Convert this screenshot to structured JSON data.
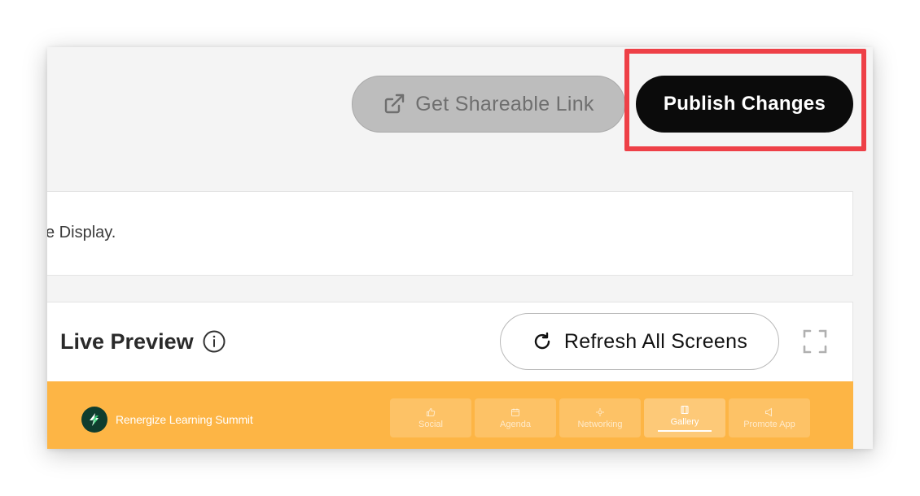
{
  "header": {
    "share_label": "Get Shareable Link",
    "publish_label": "Publish Changes"
  },
  "notice": {
    "text": "e Display."
  },
  "preview": {
    "title": "Live Preview",
    "refresh_label": "Refresh All Screens"
  },
  "banner": {
    "event_name": "Renergize Learning Summit",
    "nav": [
      {
        "label": "Social",
        "icon": "thumbs-up-icon"
      },
      {
        "label": "Agenda",
        "icon": "calendar-icon"
      },
      {
        "label": "Networking",
        "icon": "network-icon"
      },
      {
        "label": "Gallery",
        "icon": "gallery-icon"
      },
      {
        "label": "Promote App",
        "icon": "megaphone-icon"
      }
    ],
    "active_nav": "Gallery"
  },
  "colors": {
    "accent_banner": "#fdb545",
    "highlight": "#ee4047",
    "publish_bg": "#0b0b0b",
    "share_bg": "#bdbdbd"
  }
}
